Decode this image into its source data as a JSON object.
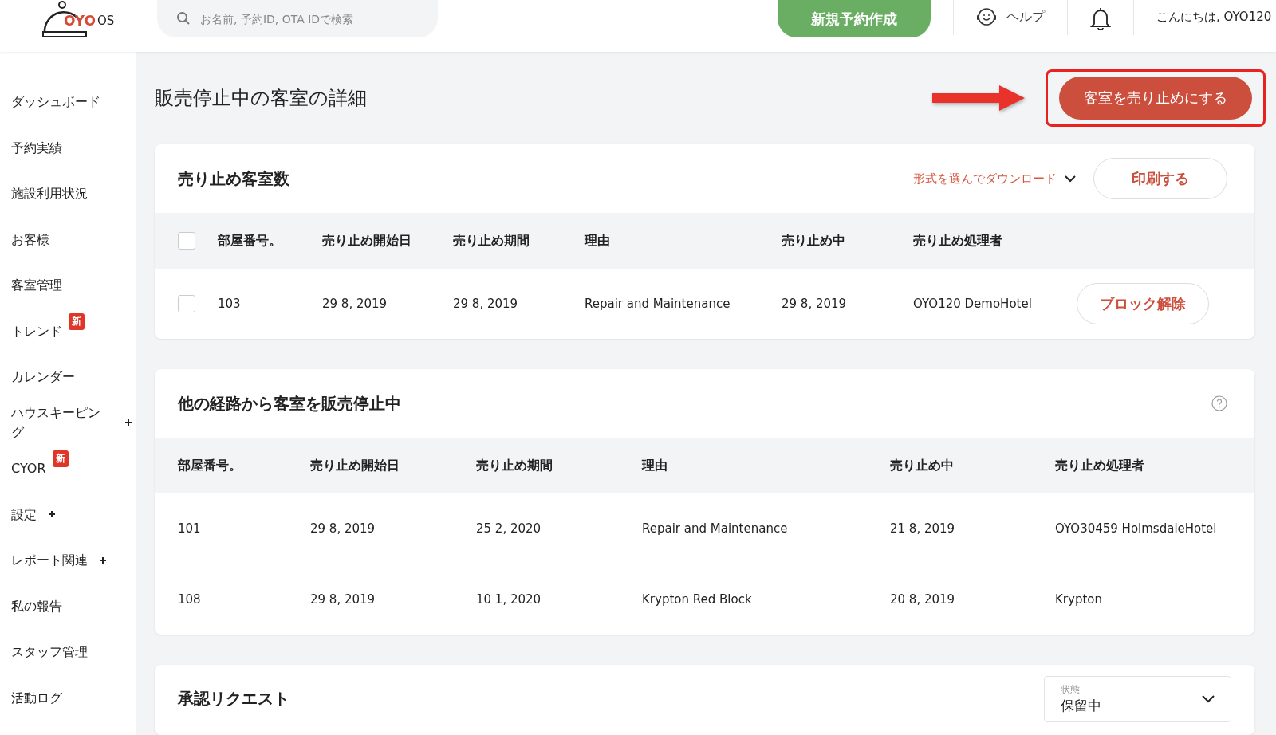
{
  "header": {
    "logo": {
      "brand": "OYO",
      "suffix": "OS"
    },
    "search": {
      "placeholder": "お名前, 予約ID, OTA IDで検索"
    },
    "new_booking_button": "新規予約作成",
    "help": "ヘルプ",
    "greeting": "こんにちは, OYO120"
  },
  "sidebar": {
    "items": [
      {
        "label": "ダッシュボード",
        "expandable": false
      },
      {
        "label": "予約実績",
        "expandable": false
      },
      {
        "label": "施設利用状況",
        "expandable": false
      },
      {
        "label": "お客様",
        "expandable": false
      },
      {
        "label": "客室管理",
        "expandable": false
      },
      {
        "label": "トレンド",
        "badge": "新",
        "expandable": false
      },
      {
        "label": "カレンダー",
        "expandable": false
      },
      {
        "label": "ハウスキーピング",
        "expandable": true
      },
      {
        "label": "CYOR",
        "badge": "新",
        "expandable": false
      },
      {
        "label": "設定",
        "expandable": true
      },
      {
        "label": "レポート関連",
        "expandable": true
      },
      {
        "label": "私の報告",
        "expandable": false
      },
      {
        "label": "スタッフ管理",
        "expandable": false
      },
      {
        "label": "活動ログ",
        "expandable": false
      }
    ]
  },
  "page": {
    "title": "販売停止中の客室の詳細",
    "block_button": "客室を売り止めにする",
    "highlighted": true
  },
  "blocked_rooms": {
    "title": "売り止め客室数",
    "download": "形式を選んでダウンロード",
    "print_button": "印刷する",
    "columns": [
      "部屋番号。",
      "売り止め開始日",
      "売り止め期間",
      "理由",
      "売り止め中",
      "売り止め処理者"
    ],
    "all_checked": false,
    "rows": [
      {
        "checked": false,
        "cells": [
          "103",
          "29 8, 2019",
          "29 8, 2019",
          "Repair and Maintenance",
          "29 8, 2019",
          "OYO120 DemoHotel"
        ],
        "action": "ブロック解除"
      }
    ]
  },
  "other_channels": {
    "title": "他の経路から客室を販売停止中",
    "columns": [
      "部屋番号。",
      "売り止め開始日",
      "売り止め期間",
      "理由",
      "売り止め中",
      "売り止め処理者"
    ],
    "rows": [
      {
        "cells": [
          "101",
          "29 8, 2019",
          "25 2, 2020",
          "Repair and Maintenance",
          "21 8, 2019",
          "OYO30459 HolmsdaleHotel"
        ]
      },
      {
        "cells": [
          "108",
          "29 8, 2019",
          "10 1, 2020",
          "Krypton Red Block",
          "20 8, 2019",
          "Krypton"
        ]
      }
    ]
  },
  "approval_requests": {
    "title": "承認リクエスト",
    "status": {
      "label": "状態",
      "value": "保留中"
    }
  }
}
